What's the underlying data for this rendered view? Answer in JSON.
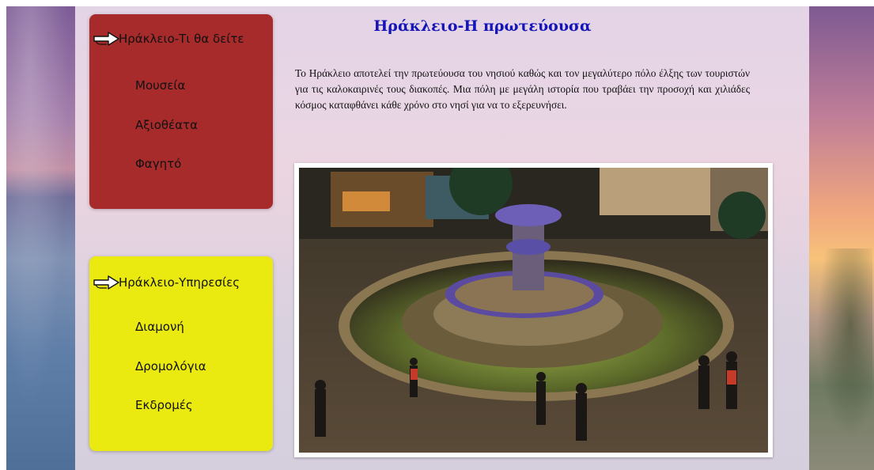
{
  "page": {
    "title": "Ηράκλειο-Η πρωτεύουσα",
    "intro": "Το Ηράκλειο αποτελεί την πρωτεύουσα του νησιού καθώς και τον μεγαλύτερο πόλο έλξης των τουριστών για τις καλοκαιρινές τους διακοπές. Μια πόλη με μεγάλη ιστορία που τραβάει την προσοχή και χιλιάδες κόσμος καταφθάνει κάθε χρόνο στο νησί για να το εξερευνήσει."
  },
  "sidebar": {
    "sections": [
      {
        "heading": "Ηράκλειο-Τι θα δείτε",
        "color": "#a72b2b",
        "items": [
          "Μουσεία",
          "Αξιοθέατα",
          "Φαγητό"
        ]
      },
      {
        "heading": "Ηράκλειο-Υπηρεσίες",
        "color": "#eaea10",
        "items": [
          "Διαμονή",
          "Δρομολόγια",
          "Εκδρομές"
        ]
      }
    ]
  },
  "colors": {
    "title": "#1414b8",
    "text": "#111111"
  },
  "icons": {
    "menu_pointer": "pointing-hand-arrow-icon"
  }
}
